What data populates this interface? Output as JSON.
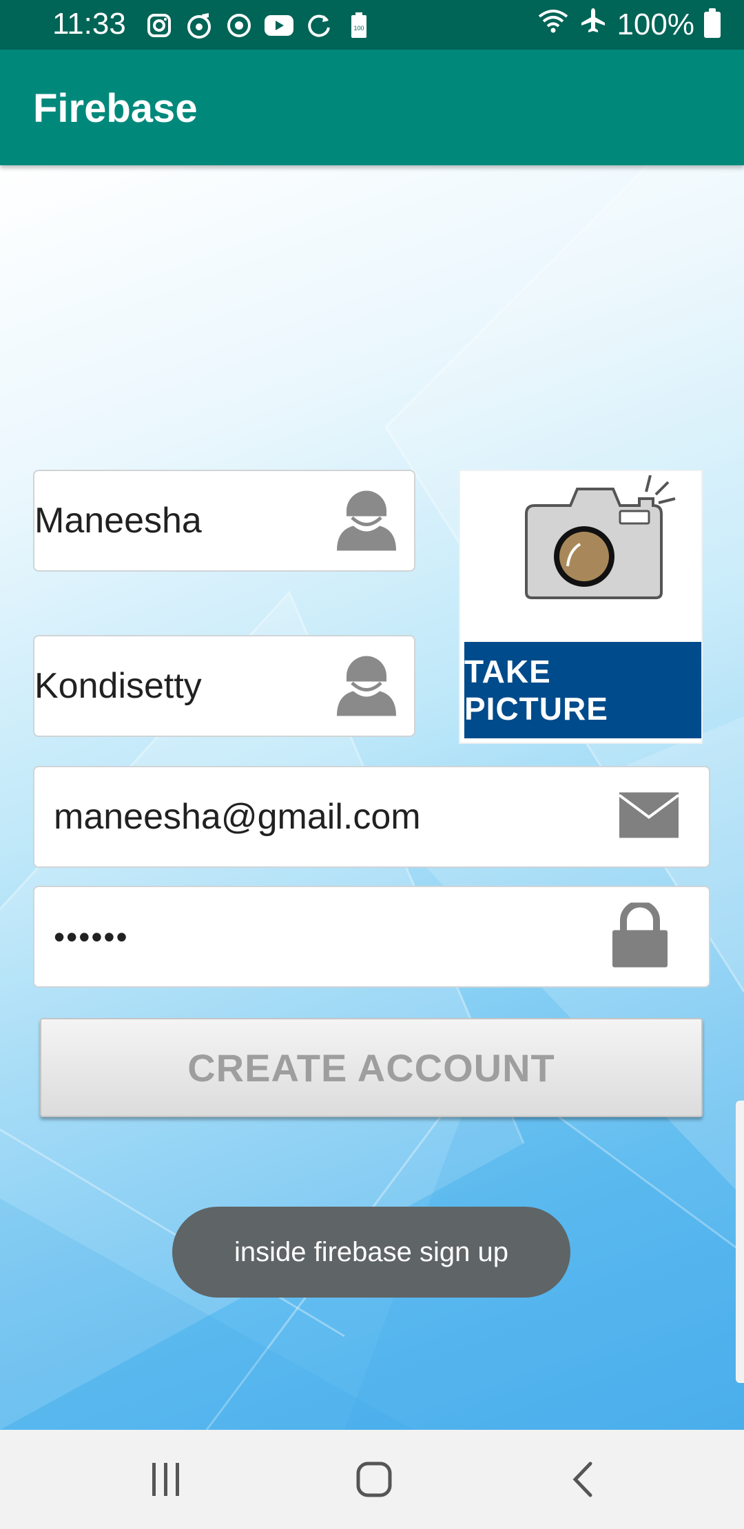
{
  "status_bar": {
    "time": "11:33",
    "battery_text": "100%",
    "left_icons": [
      "instagram-icon",
      "music-icon",
      "sync-app-icon",
      "youtube-icon",
      "refresh-icon",
      "battery-saver-icon"
    ],
    "right_icons": [
      "wifi-icon",
      "airplane-mode-icon",
      "battery-icon"
    ]
  },
  "app_bar": {
    "title": "Firebase"
  },
  "form": {
    "first_name": {
      "value": "Maneesha",
      "icon": "person-icon"
    },
    "last_name": {
      "value": "Kondisetty",
      "icon": "person-icon"
    },
    "email": {
      "value": "maneesha@gmail.com",
      "icon": "envelope-icon"
    },
    "password": {
      "value": "••••••",
      "icon": "lock-icon"
    }
  },
  "take_picture": {
    "label": "TAKE PICTURE",
    "icon": "camera-icon"
  },
  "create_button": {
    "label": "CREATE ACCOUNT"
  },
  "toast": {
    "message": "inside firebase sign up"
  },
  "nav_bar": {
    "items": [
      "recent-apps-icon",
      "home-icon",
      "back-icon"
    ]
  },
  "colors": {
    "status_bar": "#006456",
    "app_bar": "#00897b",
    "banner": "#004b8b",
    "toast": "#5f6466"
  }
}
